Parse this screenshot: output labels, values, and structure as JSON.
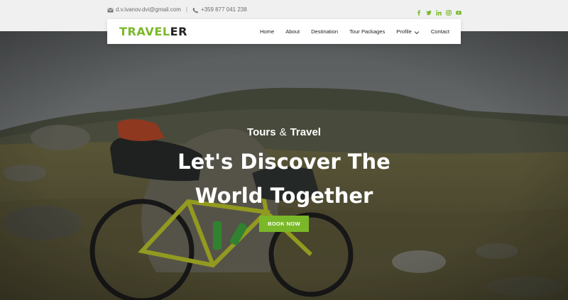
{
  "topbar": {
    "email": "d.v.ivanov.dvi@gmail.com",
    "separator": "|",
    "phone": "+359 877 041 238",
    "social_icons": [
      "facebook-icon",
      "twitter-icon",
      "linkedin-icon",
      "instagram-icon",
      "youtube-icon"
    ],
    "social_color": "#7ab829"
  },
  "logo": {
    "part1": "TRAVEL",
    "part2": "ER"
  },
  "nav": {
    "items": [
      {
        "label": "Home"
      },
      {
        "label": "About"
      },
      {
        "label": "Destination"
      },
      {
        "label": "Tour Packages"
      },
      {
        "label": "Profile"
      },
      {
        "label": "Contact"
      }
    ]
  },
  "hero": {
    "tagline_left": "Tours",
    "tagline_amp": "&",
    "tagline_right": "Travel",
    "headline_line1": "Let's Discover The",
    "headline_line2": "World Together",
    "cta_label": "BOOK NOW"
  },
  "colors": {
    "accent": "#7ab829",
    "text_dark": "#222222"
  }
}
